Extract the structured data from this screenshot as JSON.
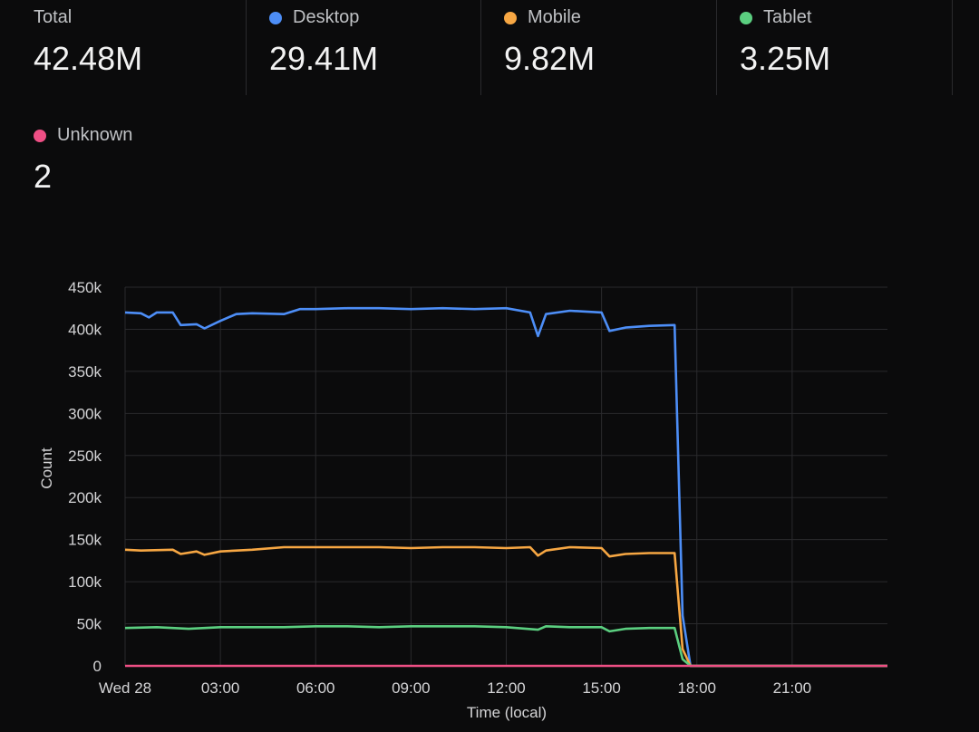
{
  "stats": [
    {
      "label": "Total",
      "value": "42.48M",
      "color": ""
    },
    {
      "label": "Desktop",
      "value": "29.41M",
      "color": "#4d8ef7"
    },
    {
      "label": "Mobile",
      "value": "9.82M",
      "color": "#f7a743"
    },
    {
      "label": "Tablet",
      "value": "3.25M",
      "color": "#5bcf80"
    },
    {
      "label": "Unknown",
      "value": "2",
      "color": "#ef4f85"
    }
  ],
  "chart_data": {
    "type": "line",
    "title": "",
    "xlabel": "Time (local)",
    "ylabel": "Count",
    "xticks": [
      "Wed 28",
      "03:00",
      "06:00",
      "09:00",
      "12:00",
      "15:00",
      "18:00",
      "21:00"
    ],
    "x_range_hours": [
      0,
      24
    ],
    "yticks": [
      "0",
      "50k",
      "100k",
      "150k",
      "200k",
      "250k",
      "300k",
      "350k",
      "400k",
      "450k"
    ],
    "ylim": [
      0,
      450000
    ],
    "grid": true,
    "series": [
      {
        "name": "Desktop",
        "color": "#4d8ef7",
        "points": [
          [
            0,
            420000
          ],
          [
            0.5,
            419000
          ],
          [
            0.75,
            414000
          ],
          [
            1.0,
            420000
          ],
          [
            1.5,
            420000
          ],
          [
            1.75,
            405000
          ],
          [
            2.25,
            406000
          ],
          [
            2.5,
            401000
          ],
          [
            3.0,
            410000
          ],
          [
            3.5,
            418000
          ],
          [
            4.0,
            419000
          ],
          [
            5.0,
            418000
          ],
          [
            5.5,
            424000
          ],
          [
            6.0,
            424000
          ],
          [
            7.0,
            425000
          ],
          [
            8.0,
            425000
          ],
          [
            9.0,
            424000
          ],
          [
            10.0,
            425000
          ],
          [
            11.0,
            424000
          ],
          [
            12.0,
            425000
          ],
          [
            12.75,
            420000
          ],
          [
            13.0,
            392000
          ],
          [
            13.25,
            418000
          ],
          [
            14.0,
            422000
          ],
          [
            15.0,
            420000
          ],
          [
            15.25,
            398000
          ],
          [
            15.75,
            402000
          ],
          [
            16.5,
            404000
          ],
          [
            17.3,
            405000
          ],
          [
            17.55,
            60000
          ],
          [
            17.8,
            0
          ],
          [
            24.0,
            0
          ]
        ]
      },
      {
        "name": "Mobile",
        "color": "#f7a743",
        "points": [
          [
            0,
            138000
          ],
          [
            0.5,
            137000
          ],
          [
            1.5,
            138000
          ],
          [
            1.75,
            133000
          ],
          [
            2.25,
            136000
          ],
          [
            2.5,
            132000
          ],
          [
            3.0,
            136000
          ],
          [
            4.0,
            138000
          ],
          [
            5.0,
            141000
          ],
          [
            6.0,
            141000
          ],
          [
            7.0,
            141000
          ],
          [
            8.0,
            141000
          ],
          [
            9.0,
            140000
          ],
          [
            10.0,
            141000
          ],
          [
            11.0,
            141000
          ],
          [
            12.0,
            140000
          ],
          [
            12.75,
            141000
          ],
          [
            13.0,
            131000
          ],
          [
            13.25,
            137000
          ],
          [
            14.0,
            141000
          ],
          [
            15.0,
            140000
          ],
          [
            15.25,
            130000
          ],
          [
            15.75,
            133000
          ],
          [
            16.5,
            134000
          ],
          [
            17.3,
            134000
          ],
          [
            17.55,
            20000
          ],
          [
            17.8,
            0
          ],
          [
            24.0,
            0
          ]
        ]
      },
      {
        "name": "Tablet",
        "color": "#5bcf80",
        "points": [
          [
            0,
            45000
          ],
          [
            1.0,
            46000
          ],
          [
            2.0,
            44000
          ],
          [
            3.0,
            46000
          ],
          [
            4.0,
            46000
          ],
          [
            5.0,
            46000
          ],
          [
            6.0,
            47000
          ],
          [
            7.0,
            47000
          ],
          [
            8.0,
            46000
          ],
          [
            9.0,
            47000
          ],
          [
            10.0,
            47000
          ],
          [
            11.0,
            47000
          ],
          [
            12.0,
            46000
          ],
          [
            13.0,
            43000
          ],
          [
            13.25,
            47000
          ],
          [
            14.0,
            46000
          ],
          [
            15.0,
            46000
          ],
          [
            15.25,
            41000
          ],
          [
            15.75,
            44000
          ],
          [
            16.5,
            45000
          ],
          [
            17.3,
            45000
          ],
          [
            17.55,
            8000
          ],
          [
            17.8,
            0
          ],
          [
            24.0,
            0
          ]
        ]
      },
      {
        "name": "Unknown",
        "color": "#ef4f85",
        "points": [
          [
            0,
            0
          ],
          [
            24.0,
            0
          ]
        ]
      }
    ]
  }
}
